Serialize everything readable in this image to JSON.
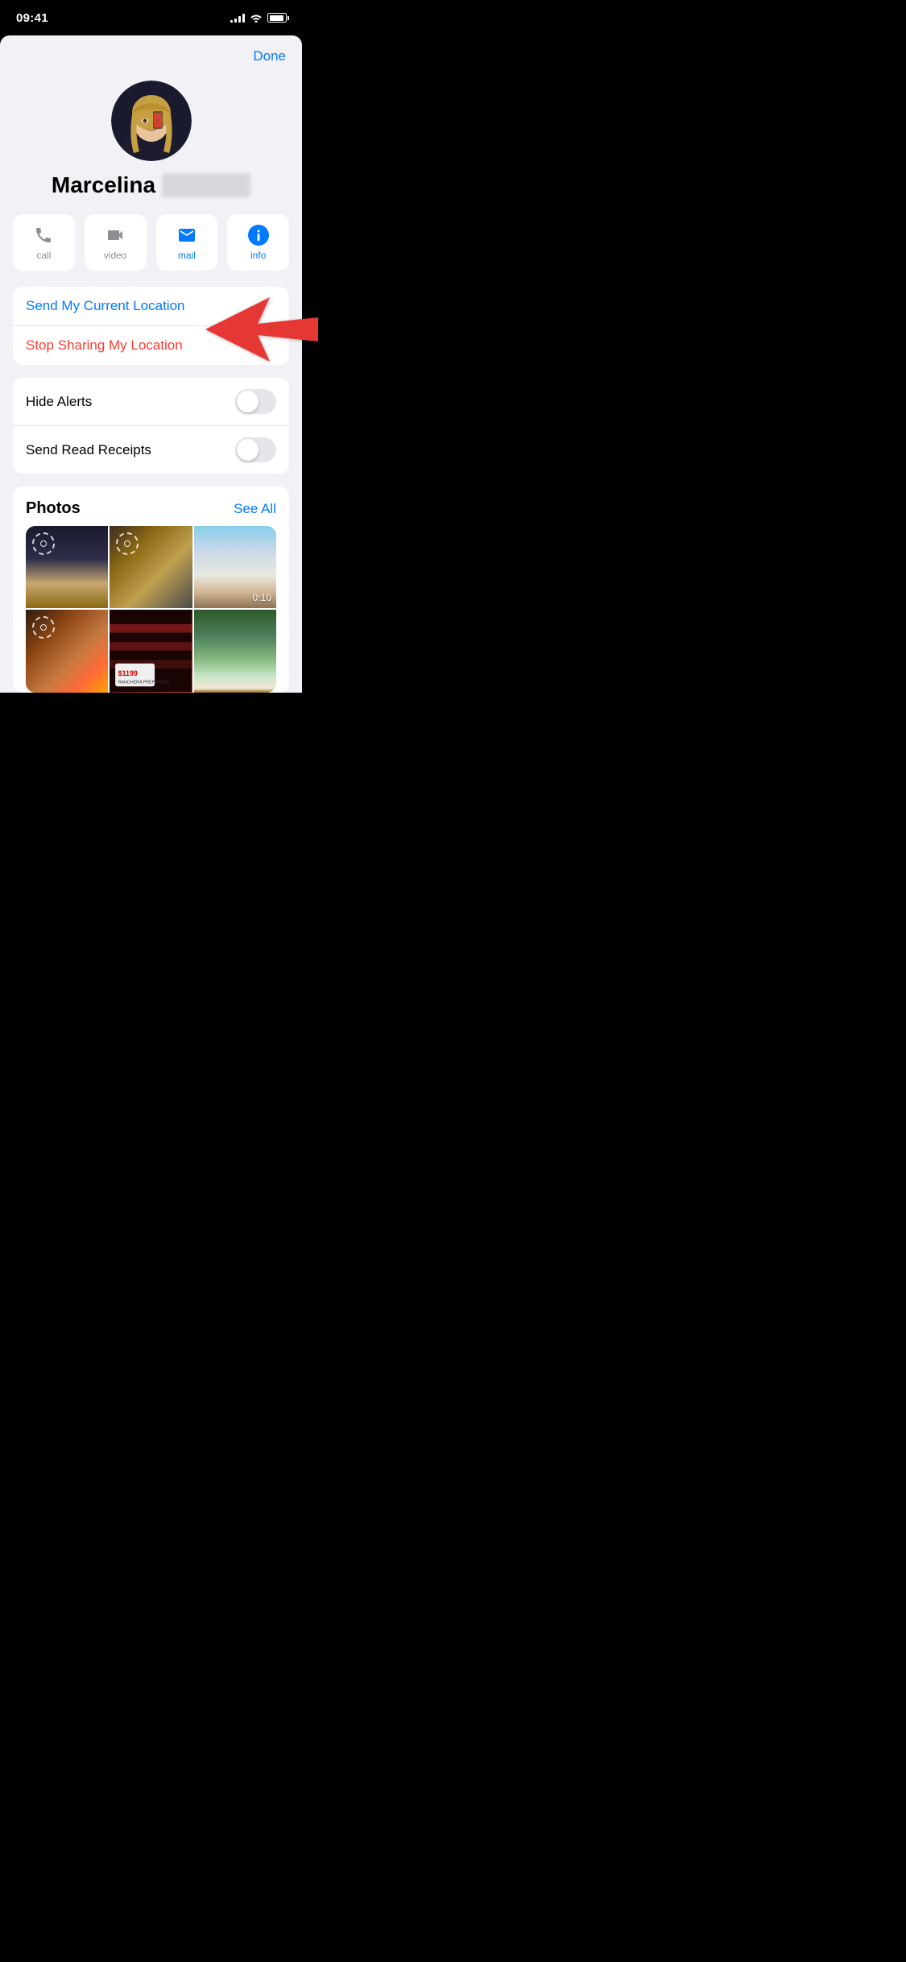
{
  "statusBar": {
    "time": "09:41"
  },
  "header": {
    "doneLabel": "Done"
  },
  "profile": {
    "firstName": "Marcelina",
    "lastNameBlurred": true
  },
  "actionButtons": [
    {
      "id": "call",
      "label": "call",
      "labelClass": "",
      "iconType": "call"
    },
    {
      "id": "video",
      "label": "video",
      "labelClass": "",
      "iconType": "video"
    },
    {
      "id": "mail",
      "label": "mail",
      "labelClass": "blue",
      "iconType": "mail"
    },
    {
      "id": "info",
      "label": "info",
      "labelClass": "blue",
      "iconType": "info"
    }
  ],
  "locationCard": {
    "sendLocationLabel": "Send My Current Location",
    "stopSharingLabel": "Stop Sharing My Location"
  },
  "settingsCard": {
    "hideAlertsLabel": "Hide Alerts",
    "hideAlertsValue": false,
    "sendReadReceiptsLabel": "Send Read Receipts",
    "sendReadReceiptsValue": false
  },
  "photosSection": {
    "title": "Photos",
    "seeAllLabel": "See All",
    "videoDuration": "0:10"
  }
}
